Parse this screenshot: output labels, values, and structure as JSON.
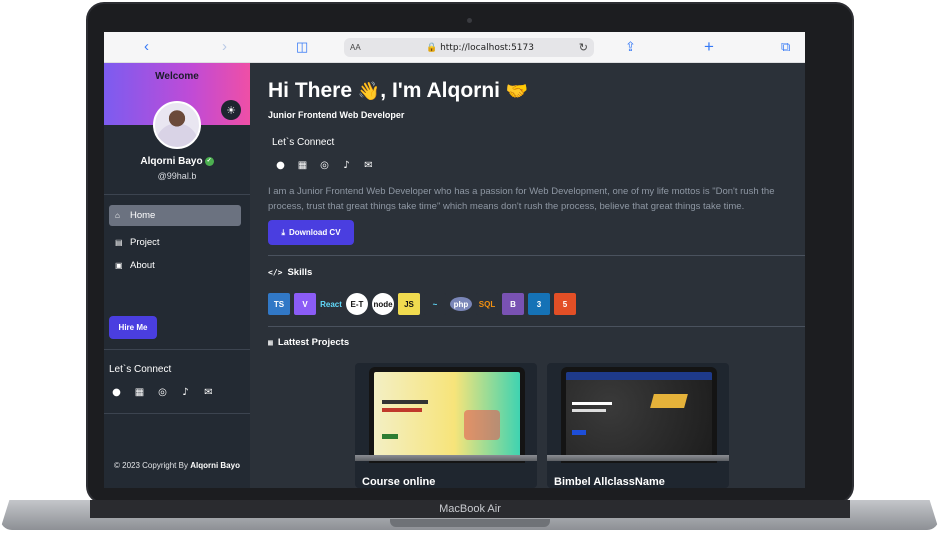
{
  "device": {
    "label": "MacBook Air"
  },
  "browser": {
    "text_size": "AA",
    "url": "http://localhost:5173"
  },
  "sidebar": {
    "welcome": "Welcome",
    "name": "Alqorni Bayo",
    "handle": "@99hal.b",
    "nav": [
      {
        "label": "Home",
        "icon": "home-icon",
        "active": true
      },
      {
        "label": "Project",
        "icon": "project-icon",
        "active": false
      },
      {
        "label": "About",
        "icon": "about-icon",
        "active": false
      }
    ],
    "hire_label": "Hire Me",
    "connect_label": "Let`s Connect",
    "copyright_prefix": "© 2023 Copyright By",
    "copyright_name": "Alqorni Bayo"
  },
  "main": {
    "title": "Hi There",
    "title_suffix": ", I'm Alqorni",
    "subtitle": "Junior Frontend Web Developer",
    "connect_label": "Let`s Connect",
    "about": "I am a Junior Frontend Web Developer who has a passion for Web Development, one of my life mottos is \"Don't rush the process, trust that great things take time\" which means don't rush the process, believe that great things take time.",
    "cv_label": "Download CV",
    "skills_title": "Skills",
    "skills": [
      {
        "label": "TS",
        "name": "typescript-icon",
        "color": "#3178c6"
      },
      {
        "label": "V",
        "name": "vite-icon",
        "color": "#8b5cf6"
      },
      {
        "label": "React",
        "name": "react-icon",
        "color": "#2b3139"
      },
      {
        "label": "E-T",
        "name": "express-icon",
        "color": "#ffffff"
      },
      {
        "label": "node",
        "name": "nodejs-icon",
        "color": "#ffffff"
      },
      {
        "label": "JS",
        "name": "javascript-icon",
        "color": "#f0db4f"
      },
      {
        "label": "~",
        "name": "tailwind-icon",
        "color": "#2b3139"
      },
      {
        "label": "php",
        "name": "php-icon",
        "color": "#7a86b8"
      },
      {
        "label": "SQL",
        "name": "mysql-icon",
        "color": "#2b3139"
      },
      {
        "label": "B",
        "name": "bootstrap-icon",
        "color": "#7952b3"
      },
      {
        "label": "3",
        "name": "css3-icon",
        "color": "#1572b6"
      },
      {
        "label": "5",
        "name": "html5-icon",
        "color": "#e34f26"
      }
    ],
    "projects_title": "Lattest Projects",
    "projects": [
      {
        "title": "Course online"
      },
      {
        "title": "Bimbel AllclassName"
      }
    ]
  }
}
